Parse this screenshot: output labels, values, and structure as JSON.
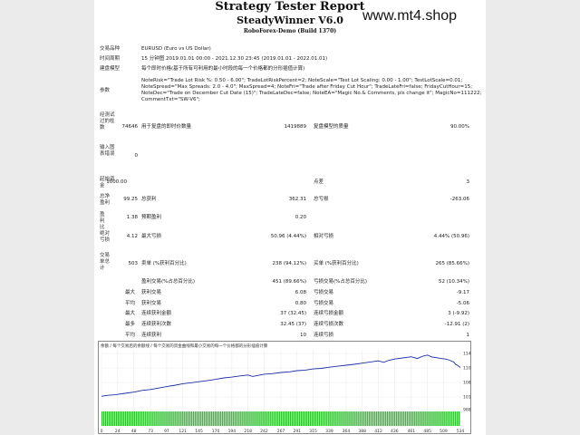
{
  "report": {
    "title": "Strategy Tester Report",
    "subtitle": "SteadyWinner V6.0",
    "build": "RoboForex-Demo (Build 1370)"
  },
  "watermark": "www.mt4.shop",
  "info": {
    "symbol_label": "交易品种",
    "symbol_value": "EURUSD (Euro vs US Dollar)",
    "period_label": "时间周期",
    "period_value": "15 分钟图 2019.01.01 00:00 - 2021.12.30 23:45 (2019.01.01 - 2022.01.01)",
    "model_label": "建盘模型",
    "model_value": "每个即时价格(基于所有可利用的最小时段的每一个价格都的分形插值计算)",
    "params_label": "参数",
    "params_lines": [
      "NoteRisk=\"Trade Lot Risk %: 0.50 - 6.00\"; TradeLotRiskPercent=2; NoteScale=\"Test Lot Scaling: 0.00 - 1.00\"; TestLotScale=0.01;",
      "NoteSpread=\"Max Spreads: 2.0 - 4.0\"; MaxSpread=4; NoteFri=\"Trade after Friday Cut Hour\"; TradeLateFri=false; FridayCutHour=15;",
      "NoteDec=\"Trade on December Cut Date (15)\"; TradeLateDec=false; NoteEA=\"Magic No.& Comments, pls change it\"; MagicNo=111222;",
      "CommentTxt=\"SW-V6\";"
    ]
  },
  "stats": {
    "bars_label": "经测试过的柱数",
    "bars_value": "74646",
    "ticks_label": "用于复盘的即时价数量",
    "ticks_value": "1419889",
    "quality_label": "复盘模型的质量",
    "quality_value": "90.00%",
    "mismatch_label": "输入图表错误",
    "mismatch_value": "0",
    "deposit_label": "起始资金",
    "deposit_value": "1000.00",
    "spread_label": "点差",
    "spread_value": "3",
    "net_label": "总净盈利",
    "net_value": "99.25",
    "gross_profit_label": "总获利",
    "gross_profit_value": "362.31",
    "gross_loss_label": "总亏损",
    "gross_loss_value": "-263.06",
    "pf_label": "盈利比",
    "pf_value": "1.38",
    "payoff_label": "预期盈利",
    "payoff_value": "0.20",
    "abs_dd_label": "绝对亏损",
    "abs_dd_value": "4.12",
    "max_dd_label": "最大亏损",
    "max_dd_value": "50.96 (4.44%)",
    "rel_dd_label": "相对亏损",
    "rel_dd_value": "4.44% (50.96)",
    "trades_label": "交易单总计",
    "trades_value": "503",
    "short_label": "卖单 (%获利百分比)",
    "short_value": "238 (94.12%)",
    "long_label": "买单 (%获利百分比)",
    "long_value": "265 (85.66%)",
    "win_label": "盈利交易(%占总百分比)",
    "win_value": "451 (89.66%)",
    "loss_label": "亏损交易(%占总百分比)",
    "loss_value": "52 (10.34%)",
    "max_prefix": "最大",
    "largest_win_label": "获利交易",
    "largest_win_value": "6.08",
    "largest_loss_label": "亏损交易",
    "largest_loss_value": "-9.17",
    "avg_prefix": "平均",
    "avg_win_label": "获利交易",
    "avg_win_value": "0.80",
    "avg_loss_label": "亏损交易",
    "avg_loss_value": "-5.06",
    "max2_prefix": "最大",
    "cons_wins_label": "连续获利金额",
    "cons_wins_value": "37 (32.45)",
    "cons_losses_label": "连续亏损金额",
    "cons_losses_value": "3 (-9.92)",
    "most_prefix": "最多",
    "cons_profit_label": "连续获利次数",
    "cons_profit_value": "32.45 (37)",
    "cons_loss_label": "连续亏损次数",
    "cons_loss_value": "-12.91 (2)",
    "avg2_prefix": "平均",
    "avg_cons_wins_label": "连续获利",
    "avg_cons_wins_value": "10",
    "avg_cons_losses_label": "连续亏损",
    "avg_cons_losses_value": "1"
  },
  "chart_data": {
    "type": "line",
    "legend": "余额 / 每个交易后的余额线 / 每个交易的资金曲线和最小交易的每一个价格都的分形插值计算",
    "xlabel": "",
    "ylabel": "",
    "x_ticks": [
      "0",
      "24",
      "48",
      "73",
      "97",
      "121",
      "145",
      "170",
      "194",
      "218",
      "242",
      "267",
      "291",
      "315",
      "339",
      "364",
      "388",
      "412",
      "436",
      "461",
      "485",
      "509",
      "534"
    ],
    "y_ticks": [
      "1148",
      "1100",
      "1080",
      "1010",
      "988"
    ],
    "xlim": [
      0,
      534
    ],
    "ylim": [
      960,
      1160
    ],
    "series": [
      {
        "values": [
          [
            0,
            1000
          ],
          [
            10,
            1003
          ],
          [
            20,
            1005
          ],
          [
            35,
            1010
          ],
          [
            50,
            1015
          ],
          [
            60,
            1020
          ],
          [
            73,
            1023
          ],
          [
            85,
            1028
          ],
          [
            97,
            1033
          ],
          [
            110,
            1038
          ],
          [
            121,
            1043
          ],
          [
            135,
            1047
          ],
          [
            145,
            1050
          ],
          [
            158,
            1054
          ],
          [
            170,
            1058
          ],
          [
            182,
            1063
          ],
          [
            194,
            1066
          ],
          [
            206,
            1070
          ],
          [
            218,
            1073
          ],
          [
            225,
            1068
          ],
          [
            233,
            1072
          ],
          [
            242,
            1076
          ],
          [
            255,
            1078
          ],
          [
            267,
            1082
          ],
          [
            280,
            1084
          ],
          [
            291,
            1088
          ],
          [
            303,
            1090
          ],
          [
            315,
            1094
          ],
          [
            327,
            1096
          ],
          [
            339,
            1100
          ],
          [
            350,
            1103
          ],
          [
            364,
            1107
          ],
          [
            376,
            1110
          ],
          [
            388,
            1114
          ],
          [
            400,
            1118
          ],
          [
            412,
            1122
          ],
          [
            420,
            1117
          ],
          [
            428,
            1124
          ],
          [
            436,
            1128
          ],
          [
            448,
            1132
          ],
          [
            461,
            1136
          ],
          [
            470,
            1130
          ],
          [
            478,
            1138
          ],
          [
            485,
            1142
          ],
          [
            492,
            1135
          ],
          [
            498,
            1133
          ],
          [
            505,
            1130
          ],
          [
            512,
            1128
          ],
          [
            518,
            1124
          ],
          [
            524,
            1118
          ],
          [
            527,
            1110
          ],
          [
            530,
            1106
          ],
          [
            534,
            1099
          ]
        ]
      }
    ],
    "bar_color": "#2fbf2f",
    "line_color": "#1c2fa8",
    "grid": true
  }
}
